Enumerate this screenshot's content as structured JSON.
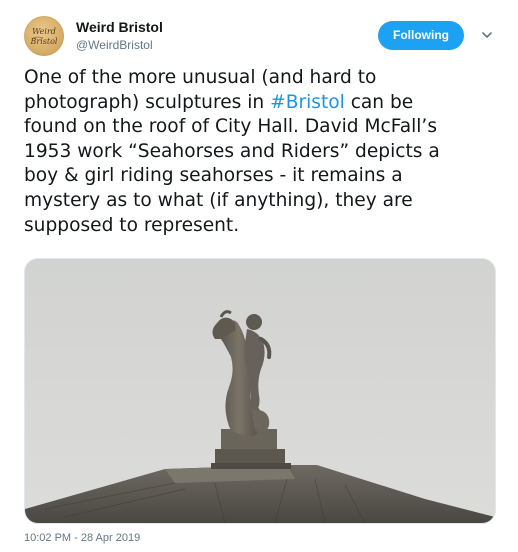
{
  "author": {
    "name": "Weird Bristol",
    "handle": "@WeirdBristol",
    "avatar_text_line1": "Weird",
    "avatar_text_line2": "Bristol"
  },
  "follow_button": {
    "label": "Following",
    "color": "#1da1f2"
  },
  "menu": {
    "icon": "chevron-down-icon"
  },
  "tweet": {
    "lines": [
      {
        "before": "One of the more unusual (and hard to",
        "hashtag": "",
        "after": ""
      },
      {
        "before": "photograph) sculptures in ",
        "hashtag": "#Bristol",
        "after": " can be"
      },
      {
        "before": "found on the roof of City Hall. David McFall’s",
        "hashtag": "",
        "after": ""
      },
      {
        "before": "1953 work “Seahorses and Riders” depicts a",
        "hashtag": "",
        "after": ""
      },
      {
        "before": "boy & girl riding seahorses - it remains a",
        "hashtag": "",
        "after": ""
      },
      {
        "before": "mystery as to what (if anything), they are",
        "hashtag": "",
        "after": ""
      },
      {
        "before": "supposed to represent.",
        "hashtag": "",
        "after": ""
      }
    ],
    "hashtag_color": "#1b95e0"
  },
  "timestamp": "10:02 PM - 28 Apr 2019"
}
